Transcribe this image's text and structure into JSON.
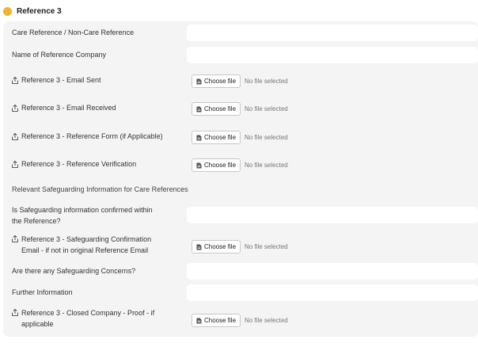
{
  "section": {
    "title": "Reference 3",
    "accent_color": "#f0b429"
  },
  "fields": {
    "care_reference": {
      "label": "Care Reference / Non-Care Reference",
      "value": ""
    },
    "company_name": {
      "label": "Name of Reference Company",
      "value": ""
    },
    "email_sent": {
      "label": "Reference 3 - Email Sent",
      "button": "Choose file",
      "status": "No file selected"
    },
    "email_received": {
      "label": "Reference 3 - Email Received",
      "button": "Choose file",
      "status": "No file selected"
    },
    "reference_form": {
      "label": "Reference 3 - Reference Form (if Applicable)",
      "button": "Choose file",
      "status": "No file selected"
    },
    "reference_verification": {
      "label": "Reference 3 - Reference Verification",
      "button": "Choose file",
      "status": "No file selected"
    },
    "safeguarding_heading": "Relevant Safeguarding Information for Care References",
    "safeguarding_confirmed": {
      "label_line1": "Is Safeguarding information confirmed within",
      "label_line2": "the Reference?",
      "value": ""
    },
    "safeguarding_email": {
      "label_line1": "Reference 3 - Safeguarding Confirmation",
      "label_line2": "Email - if not in original Reference Email",
      "button": "Choose file",
      "status": "No file selected"
    },
    "safeguarding_concerns": {
      "label": "Are there any Safeguarding Concerns?",
      "value": ""
    },
    "further_information": {
      "label": "Further Information",
      "value": ""
    },
    "closed_company": {
      "label_line1": "Reference 3 - Closed Company - Proof - if",
      "label_line2": "applicable",
      "button": "Choose file",
      "status": "No file selected"
    }
  }
}
